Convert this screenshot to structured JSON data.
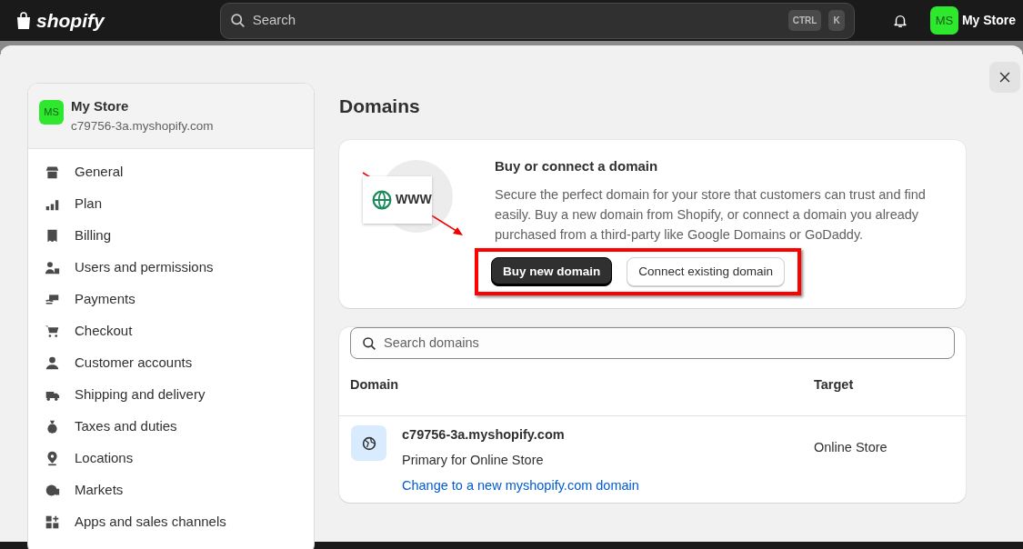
{
  "topbar": {
    "logo": "shopify",
    "search": {
      "placeholder": "Search",
      "shortcut_keys": [
        "CTRL",
        "K"
      ]
    },
    "account": {
      "initials": "MS",
      "name": "My Store"
    }
  },
  "sidebar": {
    "store": {
      "initials": "MS",
      "name": "My Store",
      "domain": "c79756-3a.myshopify.com"
    },
    "items": [
      {
        "label": "General"
      },
      {
        "label": "Plan"
      },
      {
        "label": "Billing"
      },
      {
        "label": "Users and permissions"
      },
      {
        "label": "Payments"
      },
      {
        "label": "Checkout"
      },
      {
        "label": "Customer accounts"
      },
      {
        "label": "Shipping and delivery"
      },
      {
        "label": "Taxes and duties"
      },
      {
        "label": "Locations"
      },
      {
        "label": "Markets"
      },
      {
        "label": "Apps and sales channels"
      }
    ]
  },
  "page": {
    "title": "Domains",
    "promo": {
      "illustration_text": "WWW",
      "title": "Buy or connect a domain",
      "text": "Secure the perfect domain for your store that customers can trust and find easily. Buy a new domain from Shopify, or connect a domain you already purchased from a third-party like Google Domains or GoDaddy.",
      "buttons": [
        {
          "label": "Buy new domain",
          "kind": "primary"
        },
        {
          "label": "Connect existing domain",
          "kind": "secondary"
        }
      ]
    },
    "domains": {
      "search": {
        "placeholder": "Search domains"
      },
      "columns": [
        "Domain",
        "Target"
      ],
      "rows": [
        {
          "domain": "c79756-3a.myshopify.com",
          "note": "Primary for Online Store",
          "link": "Change to a new myshopify.com domain",
          "target": "Online Store"
        }
      ]
    }
  }
}
